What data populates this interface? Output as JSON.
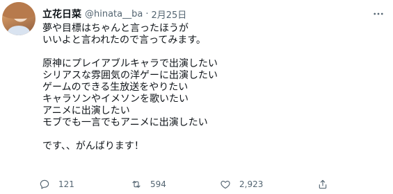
{
  "tweet": {
    "author": {
      "display_name": "立花日菜",
      "handle": "@hinata__ba",
      "separator": "·",
      "date": "2月25日"
    },
    "more_icon": "more-horizontal-icon",
    "text_lines": [
      "夢や目標はちゃんと言ったほうが",
      "いいよと言われたので言ってみます。",
      "",
      "原神にプレイアブルキャラで出演したい",
      "シリアスな雰囲気の洋ゲーに出演したい",
      "ゲームのできる生放送をやりたい",
      "キャラソンやイメソンを歌いたい",
      "アニメに出演したい",
      "モブでも一言でもアニメに出演したい",
      "",
      "です、、がんばります！"
    ],
    "actions": {
      "reply": {
        "icon": "reply-icon",
        "count": "121"
      },
      "retweet": {
        "icon": "retweet-icon",
        "count": "594"
      },
      "like": {
        "icon": "heart-icon",
        "count": "2,923"
      },
      "share": {
        "icon": "share-icon"
      }
    },
    "colors": {
      "text": "#0f1419",
      "secondary": "#536471",
      "background": "#ffffff"
    }
  }
}
